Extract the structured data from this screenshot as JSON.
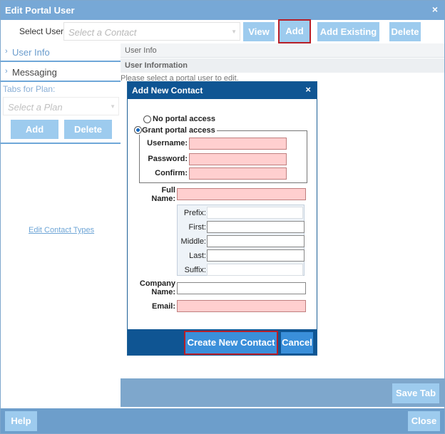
{
  "window": {
    "title": "Edit Portal User",
    "close_glyph": "×"
  },
  "toolbar": {
    "select_user_label": "Select User:",
    "select_user_placeholder": "Select a Contact",
    "view_label": "View",
    "add_label": "Add",
    "add_existing_label": "Add Existing",
    "delete_label": "Delete"
  },
  "sidebar": {
    "items": [
      {
        "label": "User Info"
      },
      {
        "label": "Messaging"
      }
    ],
    "tabs_label": "Tabs for Plan:",
    "plan_placeholder": "Select a Plan",
    "add_label": "Add",
    "delete_label": "Delete",
    "edit_contact_types": "Edit Contact Types"
  },
  "main": {
    "section_header": "User Info",
    "subsection_header": "User Information",
    "message": "Please select a portal user to edit."
  },
  "dialog": {
    "title": "Add New Contact",
    "close_glyph": "×",
    "no_access_label": "No portal access",
    "grant_access_label": "Grant portal access",
    "selected_option": "grant",
    "username_label": "Username:",
    "password_label": "Password:",
    "confirm_label": "Confirm:",
    "full_name_label_1": "Full",
    "full_name_label_2": "Name:",
    "prefix_label": "Prefix:",
    "first_label": "First:",
    "middle_label": "Middle:",
    "last_label": "Last:",
    "suffix_label": "Suffix:",
    "company_label_1": "Company",
    "company_label_2": "Name:",
    "email_label": "Email:",
    "create_label": "Create New Contact",
    "cancel_label": "Cancel"
  },
  "footer": {
    "save_tab_label": "Save Tab",
    "help_label": "Help",
    "close_label": "Close"
  },
  "colors": {
    "accent": "#9dcbee",
    "highlight": "#b81e27",
    "dialog_blue": "#0f5593",
    "required_field": "#ffcfcf"
  }
}
